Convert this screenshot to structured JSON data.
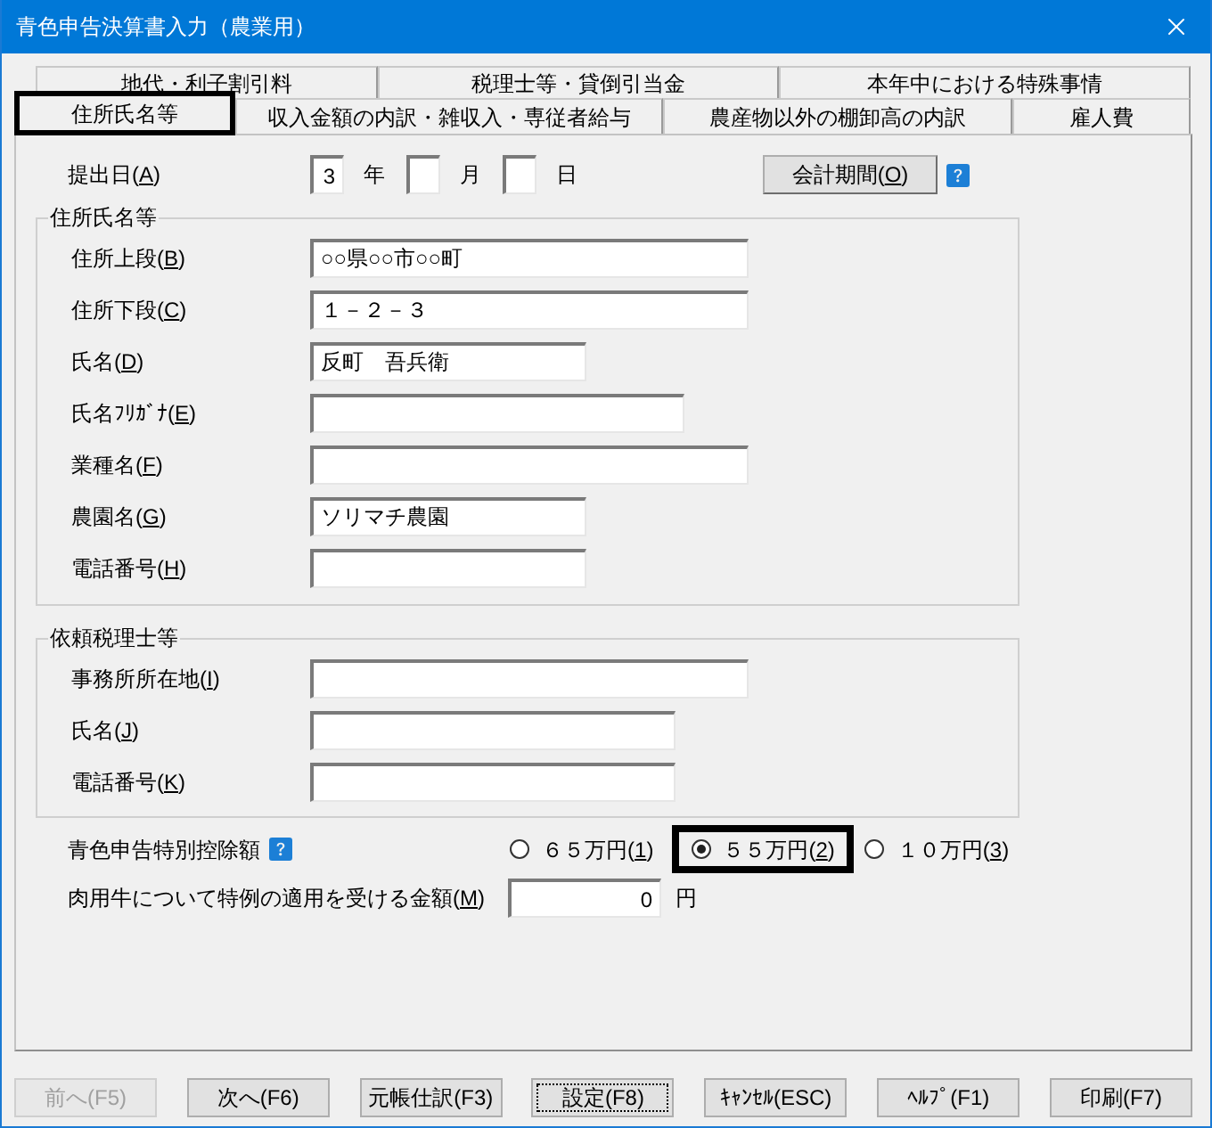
{
  "window": {
    "title": "青色申告決算書入力（農業用）"
  },
  "tab_rows": [
    {
      "tabs": [
        {
          "label": "地代・利子割引料",
          "selected": false,
          "highlighted": false
        },
        {
          "label": "税理士等・貸倒引当金",
          "selected": false,
          "highlighted": false
        },
        {
          "label": "本年中における特殊事情",
          "selected": false,
          "highlighted": false
        }
      ]
    },
    {
      "tabs": [
        {
          "label": "住所氏名等",
          "selected": true,
          "highlighted": true
        },
        {
          "label": "収入金額の内訳・雑収入・専従者給与",
          "selected": false,
          "highlighted": false
        },
        {
          "label": "農産物以外の棚卸高の内訳",
          "selected": false,
          "highlighted": false
        },
        {
          "label": "雇人費",
          "selected": false,
          "highlighted": false
        }
      ]
    }
  ],
  "submission_date": {
    "label": "提出日(A)",
    "parts": [
      {
        "value": "3",
        "unit": "年"
      },
      {
        "unit": "月"
      },
      {
        "unit": "日"
      }
    ]
  },
  "period_button": {
    "label": "会計期間(O)"
  },
  "groups": [
    {
      "title": "住所氏名等",
      "fields": [
        {
          "label": "住所上段(B)",
          "value": "○○県○○市○○町"
        },
        {
          "label": "住所下段(C)",
          "value": "１－２－３"
        },
        {
          "label": "氏名(D)",
          "value": "反町　吾兵衛"
        },
        {
          "label": "氏名ﾌﾘｶﾞﾅ(E)"
        },
        {
          "label": "業種名(F)"
        },
        {
          "label": "農園名(G)",
          "value": "ソリマチ農園"
        },
        {
          "label": "電話番号(H)"
        }
      ]
    },
    {
      "title": "依頼税理士等",
      "fields": [
        {
          "label": "事務所所在地(I)"
        },
        {
          "label": "氏名(J)"
        },
        {
          "label": "電話番号(K)"
        }
      ]
    }
  ],
  "deduction": {
    "label": "青色申告特別控除額",
    "options": [
      {
        "label": "６５万円(1)",
        "selected": false,
        "highlighted": false
      },
      {
        "label": "５５万円(2)",
        "selected": true,
        "highlighted": true
      },
      {
        "label": "１０万円(3)",
        "selected": false,
        "highlighted": false
      }
    ]
  },
  "beef_cattle": {
    "label": "肉用牛について特例の適用を受ける金額(M)",
    "value": "0",
    "unit": "円"
  },
  "buttons": [
    {
      "label": "前へ(F5)",
      "disabled": true,
      "default": false
    },
    {
      "label": "次へ(F6)",
      "disabled": false,
      "default": false
    },
    {
      "label": "元帳仕訳(F3)",
      "disabled": false,
      "default": false
    },
    {
      "label": "設定(F8)",
      "disabled": false,
      "default": true
    },
    {
      "label": "ｷｬﾝｾﾙ(ESC)",
      "disabled": false,
      "default": false
    },
    {
      "label": "ﾍﾙﾌﾟ(F1)",
      "disabled": false,
      "default": false
    },
    {
      "label": "印刷(F7)",
      "disabled": false,
      "default": false
    }
  ]
}
